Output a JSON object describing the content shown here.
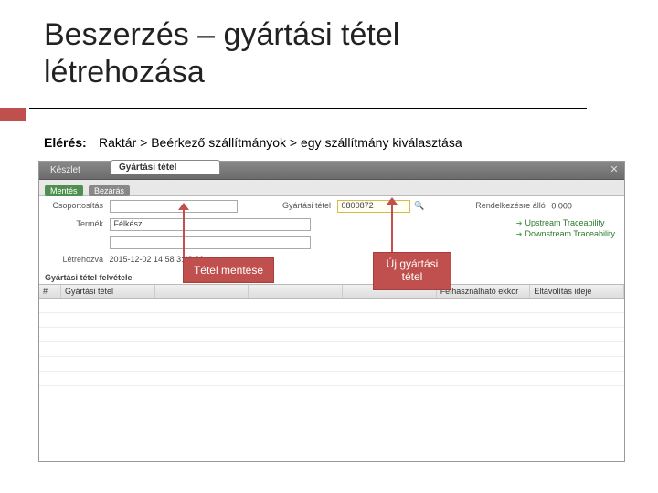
{
  "title_line1": "Beszerzés – gyártási tétel",
  "title_line2": "létrehozása",
  "access": {
    "label": "Elérés:",
    "path": "Raktár > Beérkező szállítmányok > egy szállítmány kiválasztása"
  },
  "tabs": {
    "inactive": "Készlet",
    "active": "Gyártási tétel"
  },
  "toolbar": {
    "save": "Mentés",
    "refresh": "Bezárás"
  },
  "form": {
    "row1": {
      "lbl1": "Csoportosítás",
      "lbl2": "Gyártási tétel",
      "val2": "0800872",
      "lbl3": "Rendelkezésre álló",
      "val3": "0,000"
    },
    "row2": {
      "lbl1": "Termék",
      "val1": "Félkész"
    },
    "row3": {
      "lbl1": "",
      "val1": ""
    },
    "row4": {
      "lbl1": "Létrehozva",
      "val1": "2015-12-02   14:58   3:48:30"
    }
  },
  "side_links": {
    "a": "Upstream Traceability",
    "b": "Downstream Traceability"
  },
  "grid": {
    "section": "Gyártási tétel felvétele",
    "cols": [
      "#",
      "Gyártási tétel",
      "",
      "",
      "",
      "Felhasználható ekkor",
      "Eltávolítás ideje"
    ]
  },
  "callouts": {
    "save_item": "Tétel mentése",
    "new_item": "Új gyártási tétel"
  },
  "close": "✕"
}
